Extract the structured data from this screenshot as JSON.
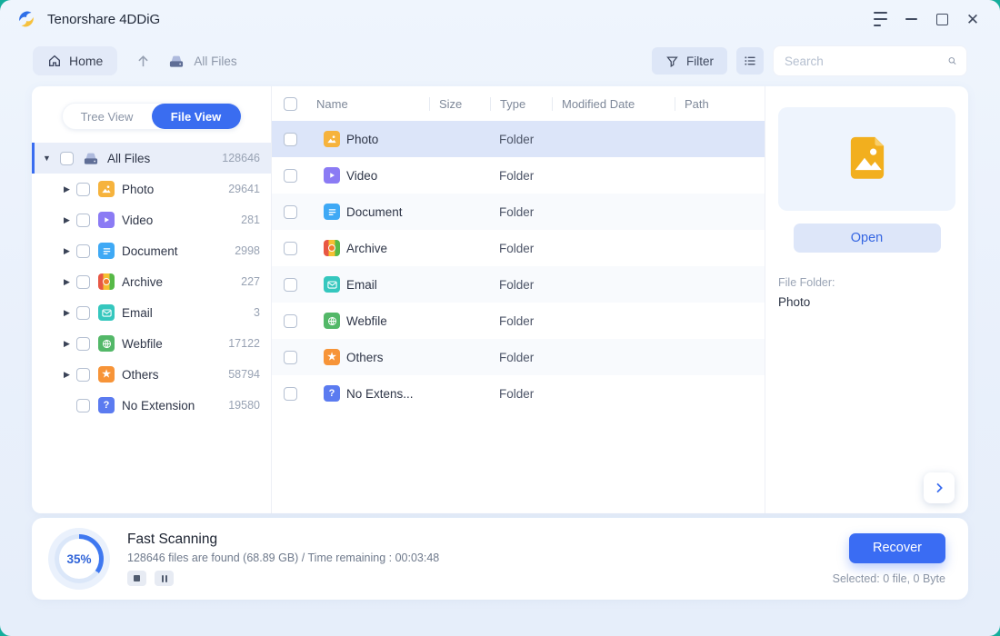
{
  "window": {
    "title": "Tenorshare 4DDiG"
  },
  "toolbar": {
    "home_label": "Home",
    "breadcrumb": "All Files",
    "filter_label": "Filter",
    "search_placeholder": "Search"
  },
  "sidebar": {
    "tabs": {
      "tree_view": "Tree View",
      "file_view": "File View"
    },
    "root": {
      "label": "All Files",
      "count": "128646",
      "icon": "all-files-icon"
    },
    "items": [
      {
        "label": "Photo",
        "count": "29641",
        "icon": "photo-icon",
        "caret": true
      },
      {
        "label": "Video",
        "count": "281",
        "icon": "video-icon",
        "caret": true
      },
      {
        "label": "Document",
        "count": "2998",
        "icon": "document-icon",
        "caret": true
      },
      {
        "label": "Archive",
        "count": "227",
        "icon": "archive-icon",
        "caret": true
      },
      {
        "label": "Email",
        "count": "3",
        "icon": "email-icon",
        "caret": true
      },
      {
        "label": "Webfile",
        "count": "17122",
        "icon": "webfile-icon",
        "caret": true
      },
      {
        "label": "Others",
        "count": "58794",
        "icon": "others-icon",
        "caret": true
      },
      {
        "label": "No Extension",
        "count": "19580",
        "icon": "no-extension-icon",
        "caret": false
      }
    ]
  },
  "table": {
    "columns": [
      "Name",
      "Size",
      "Type",
      "Modified Date",
      "Path"
    ],
    "rows": [
      {
        "name": "Photo",
        "type": "Folder",
        "icon": "photo-icon",
        "selected": true
      },
      {
        "name": "Video",
        "type": "Folder",
        "icon": "video-icon",
        "selected": false
      },
      {
        "name": "Document",
        "type": "Folder",
        "icon": "document-icon",
        "selected": false
      },
      {
        "name": "Archive",
        "type": "Folder",
        "icon": "archive-icon",
        "selected": false
      },
      {
        "name": "Email",
        "type": "Folder",
        "icon": "email-icon",
        "selected": false
      },
      {
        "name": "Webfile",
        "type": "Folder",
        "icon": "webfile-icon",
        "selected": false
      },
      {
        "name": "Others",
        "type": "Folder",
        "icon": "others-icon",
        "selected": false
      },
      {
        "name": "No Extens...",
        "type": "Folder",
        "icon": "no-extension-icon",
        "selected": false
      }
    ]
  },
  "preview": {
    "icon": "photo-icon",
    "open_label": "Open",
    "meta_label": "File Folder:",
    "meta_value": "Photo"
  },
  "statusbar": {
    "percent": "35%",
    "title": "Fast Scanning",
    "detail": "128646 files are found (68.89 GB) /  Time remaining : 00:03:48",
    "recover_label": "Recover",
    "selected_label": "Selected: 0 file, 0 Byte"
  },
  "colors": {
    "accent_blue": "#3A6DF0",
    "recover_blue": "#3A6CF3",
    "teal_backdrop": "#14AE9C",
    "selected_row": "#DCE5F9",
    "icons": {
      "all-files-icon": "#8FA3C8",
      "photo-icon": "#F6B33D",
      "video-icon": "#8B7BF4",
      "document-icon": "#3FA9F5",
      "archive-icon": "#E8703A",
      "email-icon": "#35C7BE",
      "webfile-icon": "#53B868",
      "others-icon": "#F79438",
      "no-extension-icon": "#5B7BF0"
    }
  }
}
